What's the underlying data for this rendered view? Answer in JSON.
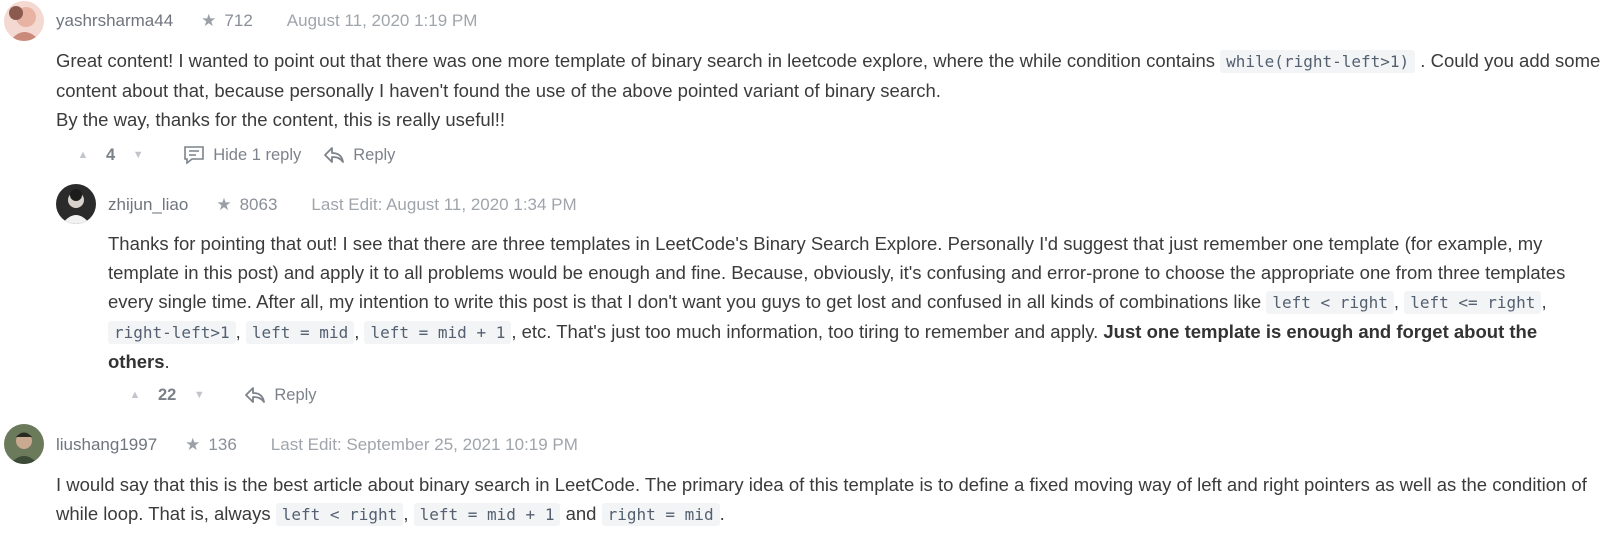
{
  "comments": [
    {
      "username": "yashrsharma44",
      "reputation": "712",
      "date": "August 11, 2020 1:19 PM",
      "line1_pre": "Great content! I wanted to point out that there was one more template of binary search in leetcode explore, where the while condition contains ",
      "line1_code": "while(right-left>1)",
      "line1_post": " . Could you add some content about that, because personally I haven't found the use of the above pointed variant of binary search.",
      "line2": "By the way, thanks for the content, this is really useful!!",
      "votes": "4",
      "hide_label": "Hide 1 reply",
      "reply_label": "Reply"
    },
    {
      "username": "zhijun_liao",
      "reputation": "8063",
      "date": "Last Edit: August 11, 2020 1:34 PM",
      "text1": "Thanks for pointing that out! I see that there are three templates in LeetCode's Binary Search Explore. Personally I'd suggest that just remember one template (for example, my template in this post) and apply it to all problems would be enough and fine. Because, obviously, it's confusing and error-prone to choose the appropriate one from three templates every single time. After all, my intention to write this post is that I don't want you guys to get lost and confused in all kinds of combinations like ",
      "code1": "left < right",
      "sep1": ", ",
      "code2": "left <= right",
      "sep2": ", ",
      "code3": "right-left>1",
      "sep3": ", ",
      "code4": "left = mid",
      "sep4": ", ",
      "code5": "left = mid + 1",
      "text2": ", etc. That's just too much information, too tiring to remember and apply. ",
      "bold": "Just one template is enough and forget about the others",
      "text3": ".",
      "votes": "22",
      "reply_label": "Reply"
    },
    {
      "username": "liushang1997",
      "reputation": "136",
      "date": "Last Edit: September 25, 2021 10:19 PM",
      "text1": "I would say that this is the best article about binary search in LeetCode. The primary idea of this template is to define a fixed moving way of left and right pointers as well as the condition of while loop. That is, always ",
      "code1": "left < right",
      "sep1": ", ",
      "code2": "left = mid + 1",
      "sep2": " and ",
      "code3": "right = mid",
      "text2": "."
    }
  ],
  "icons": {
    "star": "star-icon",
    "upvote": "caret-up-icon",
    "downvote": "caret-down-icon",
    "comment": "comment-icon",
    "reply": "reply-arrow-icon"
  }
}
